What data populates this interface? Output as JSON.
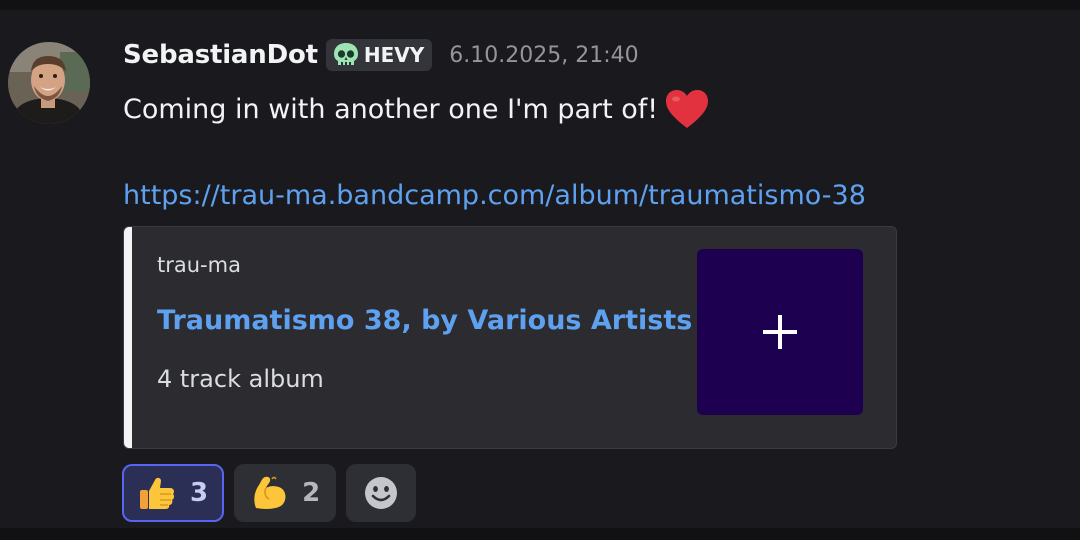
{
  "message": {
    "username": "SebastianDot",
    "tag": {
      "icon": "skull-icon",
      "label": "HEVY"
    },
    "timestamp": "6.10.2025, 21:40",
    "text": "Coming in with another one I'm part of!",
    "text_emoji": "heart-icon",
    "link": "https://trau-ma.bandcamp.com/album/traumatismo-38"
  },
  "embed": {
    "provider": "trau-ma",
    "title": "Traumatismo 38, by Various Artists",
    "description": "4 track album",
    "thumbnail_color": "#1e0050",
    "thumbnail_icon": "plus-icon"
  },
  "reactions": [
    {
      "emoji": "thumbs-up-icon",
      "count": "3",
      "active": true
    },
    {
      "emoji": "flexed-biceps-icon",
      "count": "2",
      "active": false
    }
  ],
  "add_reaction": {
    "icon": "smiley-icon"
  },
  "colors": {
    "link": "#5ea1f0",
    "accent": "#5865f2",
    "background": "#1a1a1e",
    "embed_background": "#2b2b30"
  }
}
